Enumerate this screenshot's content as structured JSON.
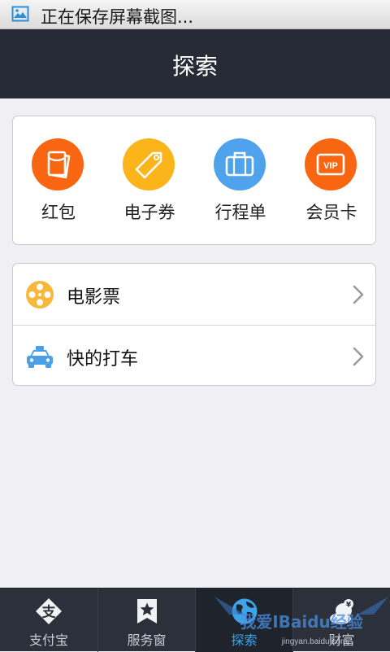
{
  "status_bar": {
    "icon": "image-icon",
    "text": "正在保存屏幕截图..."
  },
  "header": {
    "title": "探索"
  },
  "grid": [
    {
      "label": "红包",
      "icon": "red-envelope-icon",
      "color": "#f86611"
    },
    {
      "label": "电子券",
      "icon": "coupon-tag-icon",
      "color": "#fbb41a"
    },
    {
      "label": "行程单",
      "icon": "suitcase-icon",
      "color": "#4ea3ec"
    },
    {
      "label": "会员卡",
      "icon": "vip-card-icon",
      "color": "#f86611",
      "badge": "VIP"
    }
  ],
  "list": [
    {
      "label": "电影票",
      "icon": "film-reel-icon",
      "color": "#f7b73a"
    },
    {
      "label": "快的打车",
      "icon": "taxi-icon",
      "color": "#4a9fe6"
    }
  ],
  "tabs": [
    {
      "label": "支付宝",
      "icon": "alipay-icon",
      "glyph": "支"
    },
    {
      "label": "服务窗",
      "icon": "service-window-icon"
    },
    {
      "label": "探索",
      "icon": "explore-globe-icon",
      "active": true
    },
    {
      "label": "财富",
      "icon": "wealth-icon"
    }
  ],
  "watermark": {
    "text": "我爱IBaidu经验",
    "subtext": "jingyan.baidu.com"
  }
}
